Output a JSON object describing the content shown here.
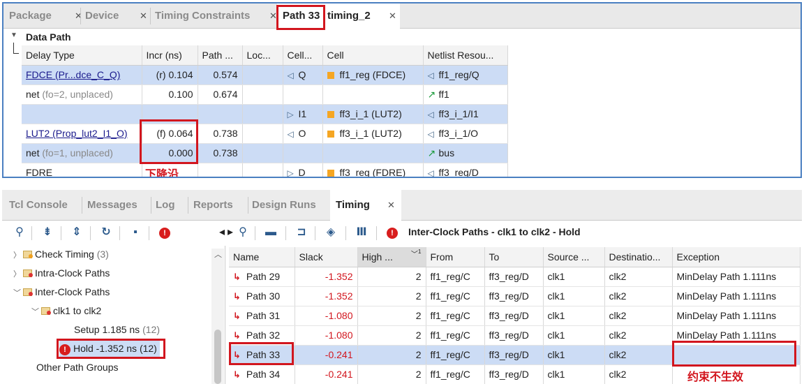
{
  "top_tabs": [
    {
      "label": "Package"
    },
    {
      "label": "Device"
    },
    {
      "label": "Timing Constraints"
    },
    {
      "label": "Path 33"
    },
    {
      "label": "timing_2"
    }
  ],
  "data_path": {
    "title": "Data Path",
    "columns": [
      "Delay Type",
      "Incr (ns)",
      "Path ...",
      "Loc...",
      "Cell...",
      "Cell",
      "Netlist Resou..."
    ],
    "rows": [
      {
        "delay_type": "FDCE (Pr...dce_C_Q)",
        "delay_note": "",
        "incr": "(r) 0.104",
        "path": "0.574",
        "loc": "",
        "cell_pin_icon": "pin-output-icon",
        "cell_pin": "Q",
        "cell": "ff1_reg (FDCE)",
        "netlist_icon": "pin-output-icon",
        "netlist": "ff1_reg/Q"
      },
      {
        "delay_type": "net",
        "delay_note": " (fo=2, unplaced)",
        "incr": "0.100",
        "path": "0.674",
        "loc": "",
        "cell_pin_icon": "",
        "cell_pin": "",
        "cell": "",
        "netlist_icon": "net-icon",
        "netlist": "ff1"
      },
      {
        "delay_type": "",
        "delay_note": "",
        "incr": "",
        "path": "",
        "loc": "",
        "cell_pin_icon": "pin-input-icon",
        "cell_pin": "I1",
        "cell": "ff3_i_1 (LUT2)",
        "netlist_icon": "pin-output-icon",
        "netlist": "ff3_i_1/I1"
      },
      {
        "delay_type": "LUT2 (Prop_lut2_I1_O)",
        "delay_note": "",
        "incr": "(f) 0.064",
        "path": "0.738",
        "loc": "",
        "cell_pin_icon": "pin-output-icon",
        "cell_pin": "O",
        "cell": "ff3_i_1 (LUT2)",
        "netlist_icon": "pin-output-icon",
        "netlist": "ff3_i_1/O"
      },
      {
        "delay_type": "net",
        "delay_note": " (fo=1, unplaced)",
        "incr": "0.000",
        "path": "0.738",
        "loc": "",
        "cell_pin_icon": "",
        "cell_pin": "",
        "cell": "",
        "netlist_icon": "net-icon",
        "netlist": "bus"
      },
      {
        "delay_type": "FDRE",
        "delay_note": "",
        "incr": "",
        "path": "",
        "loc": "",
        "cell_pin_icon": "pin-input-icon",
        "cell_pin": "D",
        "cell": "ff3_reg (FDRE)",
        "netlist_icon": "pin-output-icon",
        "netlist": "ff3_reg/D"
      }
    ],
    "annotation": "下降沿"
  },
  "bottom_tabs": [
    {
      "label": "Tcl Console"
    },
    {
      "label": "Messages"
    },
    {
      "label": "Log"
    },
    {
      "label": "Reports"
    },
    {
      "label": "Design Runs"
    },
    {
      "label": "Timing"
    }
  ],
  "timing_header": "Inter-Clock Paths - clk1 to clk2 - Hold",
  "tree": [
    {
      "label": "Check Timing",
      "count": "(3)"
    },
    {
      "label": "Intra-Clock Paths",
      "count": ""
    },
    {
      "label": "Inter-Clock Paths",
      "count": ""
    },
    {
      "label": "clk1 to clk2",
      "count": ""
    },
    {
      "label": "Setup 1.185 ns",
      "count": "(12)"
    },
    {
      "label": "Hold -1.352 ns (12)",
      "count": ""
    },
    {
      "label": "Other Path Groups",
      "count": ""
    }
  ],
  "paths_table": {
    "columns": [
      "Name",
      "Slack",
      "High ...",
      "From",
      "To",
      "Source ...",
      "Destinatio...",
      "Exception"
    ],
    "sort_indicator": "1",
    "rows": [
      {
        "name": "Path 29",
        "slack": "-1.352",
        "high": "2",
        "from": "ff1_reg/C",
        "to": "ff3_reg/D",
        "source": "clk1",
        "dest": "clk2",
        "exception": "MinDelay Path 1.111ns"
      },
      {
        "name": "Path 30",
        "slack": "-1.352",
        "high": "2",
        "from": "ff1_reg/C",
        "to": "ff3_reg/D",
        "source": "clk1",
        "dest": "clk2",
        "exception": "MinDelay Path 1.111ns"
      },
      {
        "name": "Path 31",
        "slack": "-1.080",
        "high": "2",
        "from": "ff1_reg/C",
        "to": "ff3_reg/D",
        "source": "clk1",
        "dest": "clk2",
        "exception": "MinDelay Path 1.111ns"
      },
      {
        "name": "Path 32",
        "slack": "-1.080",
        "high": "2",
        "from": "ff1_reg/C",
        "to": "ff3_reg/D",
        "source": "clk1",
        "dest": "clk2",
        "exception": "MinDelay Path 1.111ns"
      },
      {
        "name": "Path 33",
        "slack": "-0.241",
        "high": "2",
        "from": "ff1_reg/C",
        "to": "ff3_reg/D",
        "source": "clk1",
        "dest": "clk2",
        "exception": ""
      },
      {
        "name": "Path 34",
        "slack": "-0.241",
        "high": "2",
        "from": "ff1_reg/C",
        "to": "ff3_reg/D",
        "source": "clk1",
        "dest": "clk2",
        "exception": ""
      }
    ],
    "annotation": "约束不生效"
  },
  "colors": {
    "highlight_row": "#ccdcf5",
    "annotation_red": "#d2161e",
    "accent_blue": "#4a7fc1"
  }
}
